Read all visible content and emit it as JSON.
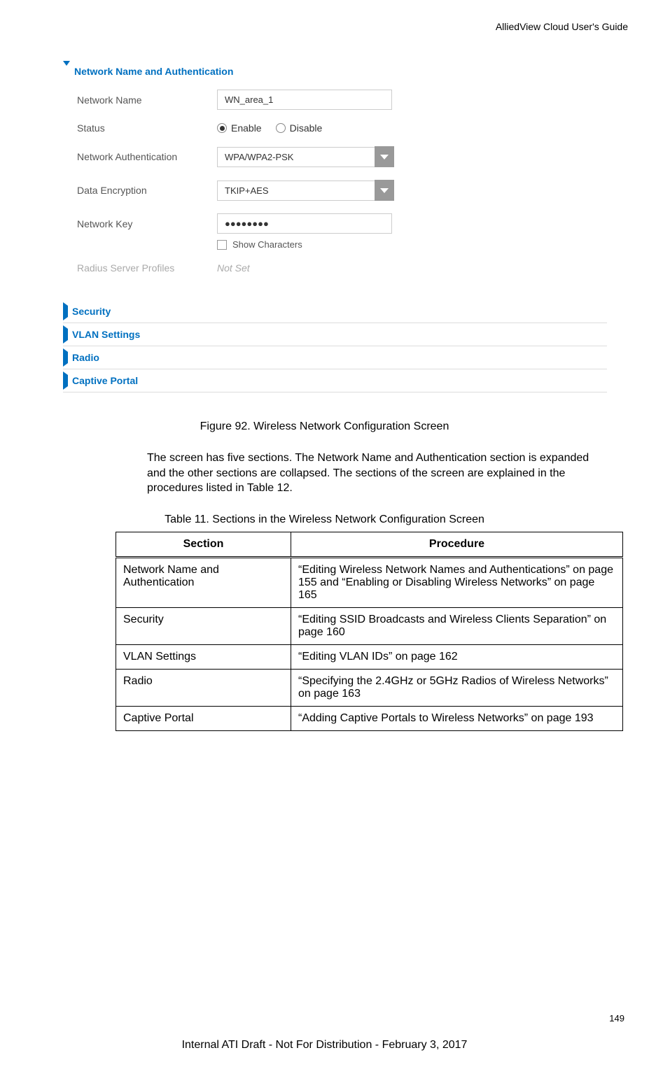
{
  "header": {
    "guide_title": "AlliedView Cloud User's Guide"
  },
  "screenshot": {
    "sections": {
      "network_auth": {
        "title": "Network Name and Authentication",
        "fields": {
          "network_name": {
            "label": "Network Name",
            "value": "WN_area_1"
          },
          "status": {
            "label": "Status",
            "enable": "Enable",
            "disable": "Disable"
          },
          "network_auth": {
            "label": "Network Authentication",
            "value": "WPA/WPA2-PSK"
          },
          "data_encryption": {
            "label": "Data Encryption",
            "value": "TKIP+AES"
          },
          "network_key": {
            "label": "Network Key",
            "value": "●●●●●●●●"
          },
          "show_chars": {
            "label": "Show Characters"
          },
          "radius": {
            "label": "Radius Server Profiles",
            "value": "Not Set"
          }
        }
      },
      "security": {
        "title": "Security"
      },
      "vlan": {
        "title": "VLAN Settings"
      },
      "radio": {
        "title": "Radio"
      },
      "captive": {
        "title": "Captive Portal"
      }
    }
  },
  "figure_caption": "Figure 92. Wireless Network Configuration Screen",
  "body_paragraph": "The screen has five sections. The Network Name and Authentication section is expanded and the other sections are collapsed. The sections of the screen are explained in the procedures listed in Table 12.",
  "table_caption": "Table 11. Sections in the Wireless Network Configuration Screen",
  "table": {
    "headers": {
      "section": "Section",
      "procedure": "Procedure"
    },
    "rows": [
      {
        "section": "Network Name and Authentication",
        "procedure": "“Editing Wireless Network Names and Authentications” on page 155 and “Enabling or Disabling Wireless Networks” on page 165"
      },
      {
        "section": "Security",
        "procedure": "“Editing SSID Broadcasts and Wireless Clients Separation” on page 160"
      },
      {
        "section": "VLAN Settings",
        "procedure": "“Editing VLAN IDs” on page 162"
      },
      {
        "section": "Radio",
        "procedure": "“Specifying the 2.4GHz or 5GHz Radios of Wireless Networks” on page 163"
      },
      {
        "section": "Captive Portal",
        "procedure": "“Adding Captive Portals to Wireless Networks” on page 193"
      }
    ]
  },
  "page_number": "149",
  "footer": "Internal ATI Draft - Not For Distribution - February 3, 2017"
}
